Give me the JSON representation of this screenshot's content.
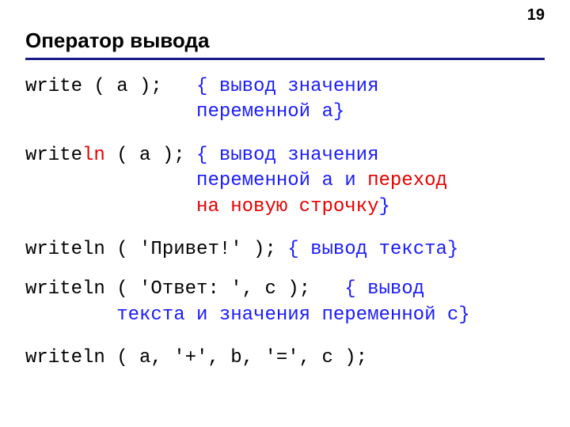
{
  "page_number": "19",
  "title": "Оператор вывода",
  "block1": {
    "code": "write ( a );   ",
    "c1": "{ вывод значения",
    "pad": "               ",
    "c2": "переменной a}"
  },
  "block2": {
    "code_a": "write",
    "code_ln": "ln",
    "code_b": " ( a ); ",
    "c1": "{ вывод значения",
    "pad": "               ",
    "c2": "переменной a и ",
    "c3": "переход",
    "c4": "на новую строчку",
    "c5": "}"
  },
  "block3": {
    "code": "writeln ( 'Привет!' ); ",
    "c1": "{ вывод текста}"
  },
  "block4": {
    "code": "writeln ( 'Ответ: ', c );   ",
    "c1": "{ вывод",
    "pad": "        ",
    "c2": "текста и значения переменной c}"
  },
  "block5": {
    "code": "writeln ( a, '+', b, '=', c );"
  }
}
